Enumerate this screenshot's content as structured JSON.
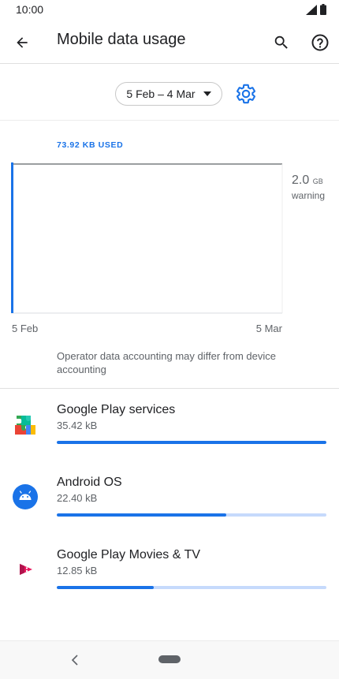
{
  "status_bar": {
    "time": "10:00"
  },
  "app_bar": {
    "title": "Mobile data usage"
  },
  "cycle": {
    "label": "5 Feb – 4 Mar"
  },
  "usage": {
    "used_label": "73.92 KB USED",
    "warning_value": "2.0",
    "warning_unit": "GB",
    "warning_label": "warning",
    "axis_start": "5 Feb",
    "axis_end": "5 Mar"
  },
  "disclaimer": "Operator data accounting may differ from device accounting",
  "apps": [
    {
      "name": "Google Play services",
      "size": "35.42 kB",
      "fraction": 1.0,
      "icon": "google-play-services-icon"
    },
    {
      "name": "Android OS",
      "size": "22.40 kB",
      "fraction": 0.63,
      "icon": "android-os-icon"
    },
    {
      "name": "Google Play Movies & TV",
      "size": "12.85 kB",
      "fraction": 0.36,
      "icon": "google-play-movies-icon"
    }
  ],
  "colors": {
    "accent": "#1a73e8",
    "track": "#c6dafc"
  }
}
